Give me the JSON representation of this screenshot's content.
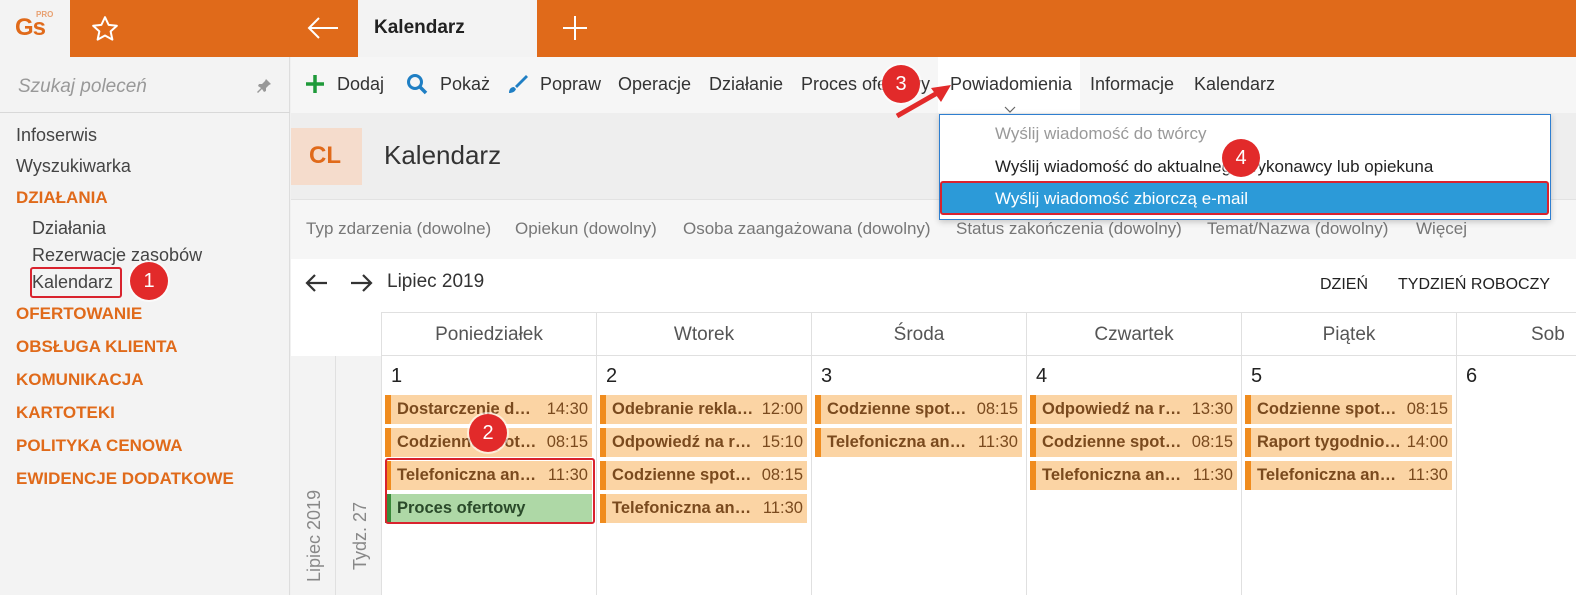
{
  "app": {
    "logo": "Gs",
    "logo_sup": "PRO",
    "tab_title": "Kalendarz"
  },
  "sidebar": {
    "search_placeholder": "Szukaj poleceń",
    "items": [
      "Infoserwis",
      "Wyszukiwarka"
    ],
    "section_dzialania": "DZIAŁANIA",
    "sub_items": [
      "Działania",
      "Rezerwacje zasobów",
      "Kalendarz"
    ],
    "sections": [
      "OFERTOWANIE",
      "OBSŁUGA KLIENTA",
      "KOMUNIKACJA",
      "KARTOTEKI",
      "POLITYKA CENOWA",
      "EWIDENCJE DODATKOWE"
    ]
  },
  "toolbar": {
    "add": "Dodaj",
    "show": "Pokaż",
    "edit": "Popraw",
    "operations": "Operacje",
    "action": "Działanie",
    "offer_process": "Proces ofertowy",
    "notifications": "Powiadomienia",
    "info": "Informacje",
    "calendar": "Kalendarz"
  },
  "header": {
    "badge": "CL",
    "title": "Kalendarz"
  },
  "filters": [
    "Typ zdarzenia (dowolne)",
    "Opiekun (dowolny)",
    "Osoba zaangażowana (dowolny)",
    "Status zakończenia (dowolny)",
    "Temat/Nazwa (dowolny)",
    "Więcej"
  ],
  "calendar": {
    "month": "Lipiec 2019",
    "view_day": "DZIEŃ",
    "view_workweek": "TYDZIEŃ ROBOCZY",
    "days": [
      "Poniedziałek",
      "Wtorek",
      "Środa",
      "Czwartek",
      "Piątek",
      "Sob"
    ],
    "day_numbers": [
      "1",
      "2",
      "3",
      "4",
      "5",
      "6"
    ],
    "side_month": "Lipiec 2019",
    "side_week": "Tydz. 27",
    "events": {
      "mon": [
        [
          "Dostarczenie du…",
          "14:30"
        ],
        [
          "Codzienne spot…",
          "08:15"
        ],
        [
          "Telefoniczna ank…",
          "11:30"
        ],
        [
          "Proces ofertowy",
          ""
        ]
      ],
      "tue": [
        [
          "Odebranie rekla…",
          "12:00"
        ],
        [
          "Odpowiedź na r…",
          "15:10"
        ],
        [
          "Codzienne spot…",
          "08:15"
        ],
        [
          "Telefoniczna ank…",
          "11:30"
        ]
      ],
      "wed": [
        [
          "Codzienne spot…",
          "08:15"
        ],
        [
          "Telefoniczna ank…",
          "11:30"
        ]
      ],
      "thu": [
        [
          "Odpowiedź na r…",
          "13:30"
        ],
        [
          "Codzienne spot…",
          "08:15"
        ],
        [
          "Telefoniczna ank…",
          "11:30"
        ]
      ],
      "fri": [
        [
          "Codzienne spot…",
          "08:15"
        ],
        [
          "Raport tygodnio…",
          "14:00"
        ],
        [
          "Telefoniczna ank…",
          "11:30"
        ]
      ]
    }
  },
  "dropdown": {
    "items": [
      "Wyślij wiadomość do twórcy",
      "Wyślij wiadomość do aktualnego wykonawcy lub opiekuna",
      "Wyślij wiadomość zbiorczą e-mail"
    ]
  },
  "annotations": [
    "1",
    "2",
    "3",
    "4"
  ],
  "colors": {
    "brand": "#e06a1a",
    "event": "#fbd4a4",
    "event_bar": "#f08c1e",
    "event_green": "#aed8a6",
    "selected": "#2c9ad8",
    "annotation": "#e22a2a"
  }
}
